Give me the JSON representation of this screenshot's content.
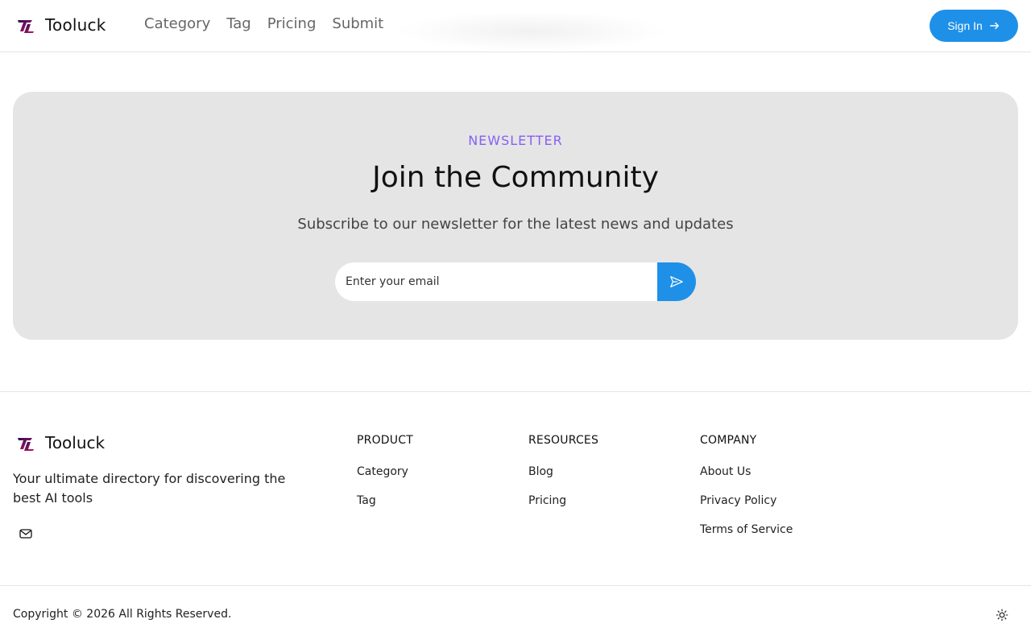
{
  "header": {
    "brand": "Tooluck",
    "nav": [
      "Category",
      "Tag",
      "Pricing",
      "Submit"
    ],
    "signin_label": "Sign In"
  },
  "newsletter": {
    "eyebrow": "NEWSLETTER",
    "title": "Join the Community",
    "subtitle": "Subscribe to our newsletter for the latest news and updates",
    "email_placeholder": "Enter your email"
  },
  "footer": {
    "brand": "Tooluck",
    "description": "Your ultimate directory for discovering the best AI tools",
    "columns": [
      {
        "title": "PRODUCT",
        "links": [
          "Category",
          "Tag"
        ]
      },
      {
        "title": "RESOURCES",
        "links": [
          "Blog",
          "Pricing"
        ]
      },
      {
        "title": "COMPANY",
        "links": [
          "About Us",
          "Privacy Policy",
          "Terms of Service"
        ]
      }
    ],
    "copyright": "Copyright © 2026 All Rights Reserved."
  },
  "colors": {
    "accent": "#1e90e8",
    "eyebrow_gradient_start": "#6366f1",
    "eyebrow_gradient_end": "#a855f7",
    "newsletter_bg": "#e5e5e5"
  },
  "icons": {
    "logo": "tooluck-logo-icon",
    "signin": "arrow-right-icon",
    "submit": "send-icon",
    "mail": "mail-icon",
    "theme": "sun-icon"
  }
}
